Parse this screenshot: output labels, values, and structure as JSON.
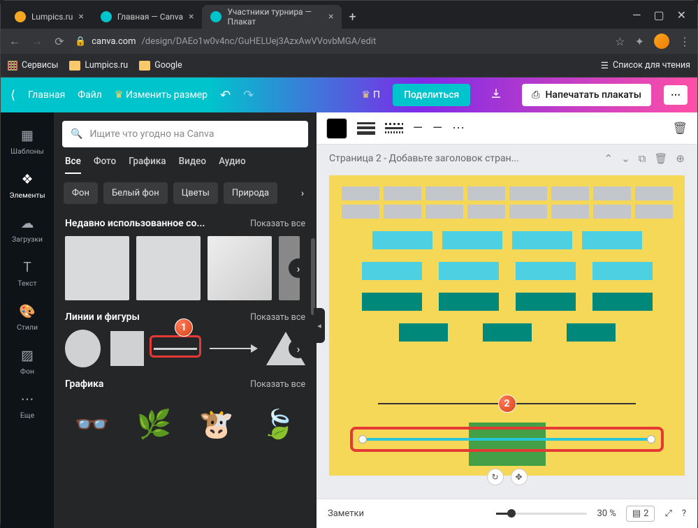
{
  "browser": {
    "tabs": [
      {
        "title": "Lumpics.ru",
        "favicon": "#f5a623"
      },
      {
        "title": "Главная — Canva",
        "favicon": "#00c4cc"
      },
      {
        "title": "Участники турнира — Плакат",
        "favicon": "#00c4cc",
        "active": true
      }
    ],
    "url_domain": "canva.com",
    "url_path": "/design/DAEo1w0v4nc/GuHELUej3AzxAwVVovbMGA/edit",
    "bookmarks": {
      "services": "Сервисы",
      "lumpics": "Lumpics.ru",
      "google": "Google",
      "readlist": "Список для чтения"
    }
  },
  "header": {
    "home": "Главная",
    "file": "Файл",
    "resize": "Изменить размер",
    "pro": "П",
    "share": "Поделиться",
    "print": "Напечатать плакаты"
  },
  "rail": {
    "templates": "Шаблоны",
    "elements": "Элементы",
    "uploads": "Загрузки",
    "text": "Текст",
    "styles": "Стили",
    "background": "Фон",
    "more": "Еще"
  },
  "panel": {
    "search_placeholder": "Ищите что угодно на Canva",
    "tabs": {
      "all": "Все",
      "photo": "Фото",
      "graphics": "Графика",
      "video": "Видео",
      "audio": "Аудио"
    },
    "chips": {
      "bg": "Фон",
      "whitebg": "Белый фон",
      "flowers": "Цветы",
      "nature": "Природа"
    },
    "sections": {
      "recent": "Недавно использованное со...",
      "lines": "Линии и фигуры",
      "graphics": "Графика",
      "showall": "Показать все"
    },
    "markers": {
      "one": "1",
      "two": "2"
    }
  },
  "canvas": {
    "page_title": "Страница 2 - Добавьте заголовок стран...",
    "notes": "Заметки",
    "zoom": "30 %",
    "pagecount": "2"
  }
}
